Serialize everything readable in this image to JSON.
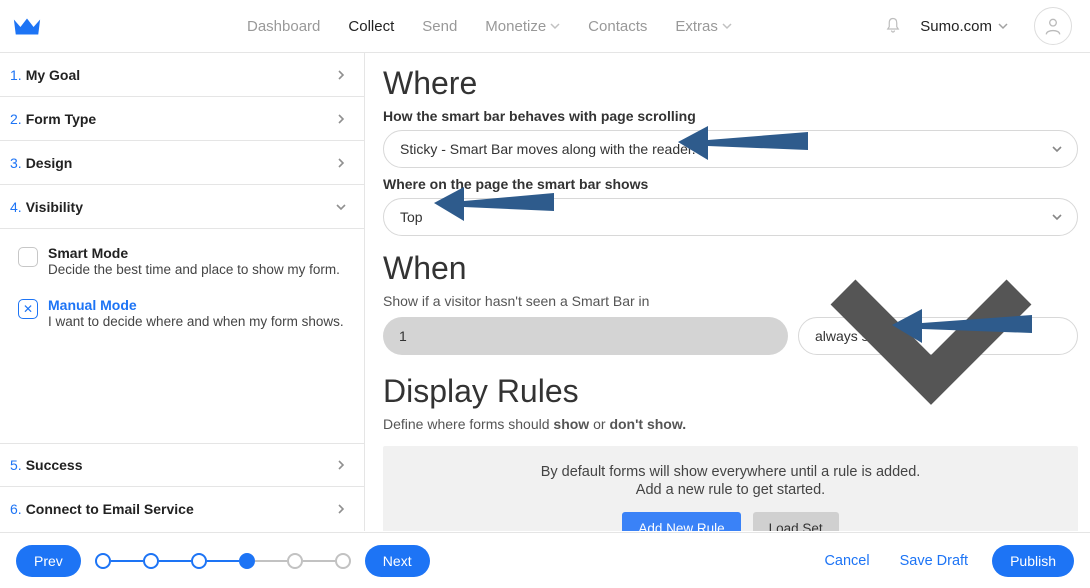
{
  "header": {
    "nav": {
      "dashboard": "Dashboard",
      "collect": "Collect",
      "send": "Send",
      "monetize": "Monetize",
      "contacts": "Contacts",
      "extras": "Extras"
    },
    "account_label": "Sumo.com"
  },
  "sidebar": {
    "items": [
      {
        "num": "1.",
        "label": "My Goal"
      },
      {
        "num": "2.",
        "label": "Form Type"
      },
      {
        "num": "3.",
        "label": "Design"
      },
      {
        "num": "4.",
        "label": "Visibility"
      },
      {
        "num": "5.",
        "label": "Success"
      },
      {
        "num": "6.",
        "label": "Connect to Email Service"
      }
    ],
    "smart_mode": {
      "title": "Smart Mode",
      "desc": "Decide the best time and place to show my form."
    },
    "manual_mode": {
      "title": "Manual Mode",
      "desc": "I want to decide where and when my form shows."
    }
  },
  "main": {
    "where": {
      "heading": "Where",
      "scroll_label": "How the smart bar behaves with page scrolling",
      "scroll_value": "Sticky - Smart Bar moves along with the reader.",
      "position_label": "Where on the page the smart bar shows",
      "position_value": "Top"
    },
    "when": {
      "heading": "When",
      "sub": "Show if a visitor hasn't seen a Smart Bar in",
      "number": "1",
      "freq": "always show"
    },
    "rules": {
      "heading": "Display Rules",
      "intro_prefix": "Define where forms should ",
      "intro_show": "show",
      "intro_mid": " or ",
      "intro_dont": "don't show.",
      "hint1": "By default forms will show everywhere until a rule is added.",
      "hint2": "Add a new rule to get started.",
      "add_btn": "Add New Rule",
      "load_btn": "Load Set"
    }
  },
  "footer": {
    "prev": "Prev",
    "next": "Next",
    "cancel": "Cancel",
    "save_draft": "Save Draft",
    "publish": "Publish"
  }
}
